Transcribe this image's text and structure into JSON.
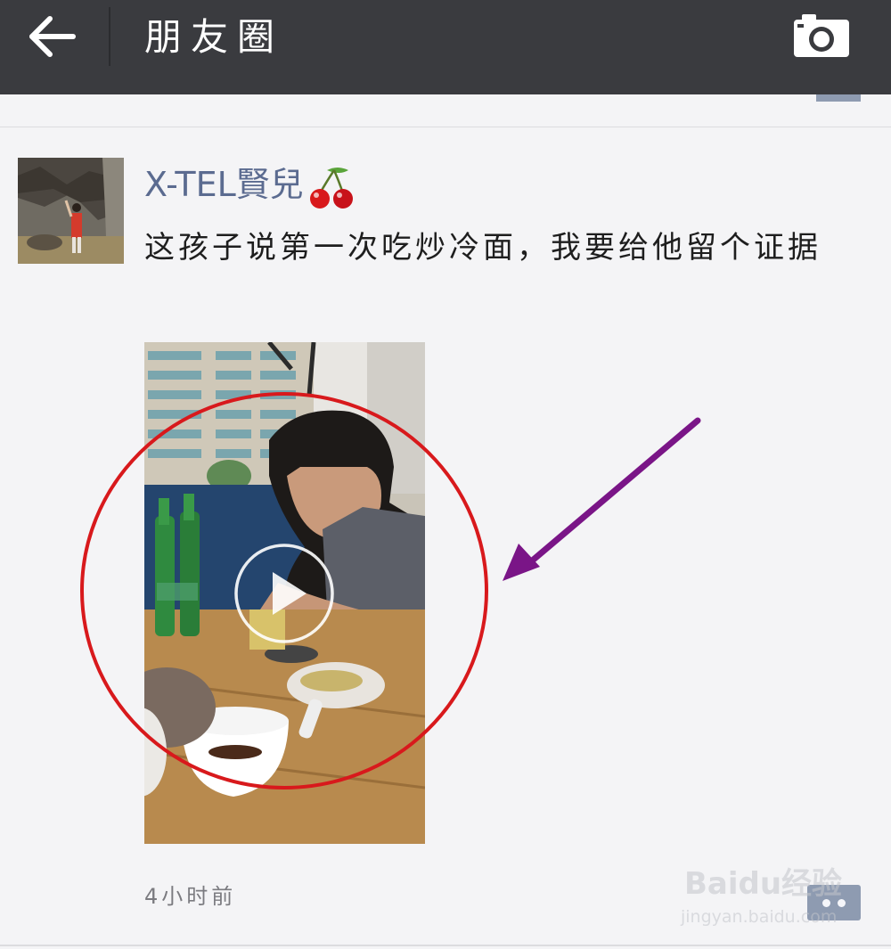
{
  "header": {
    "title": "朋友圈",
    "back_icon": "arrow-left-icon",
    "camera_icon": "camera-icon"
  },
  "post": {
    "author": "X-TEL賢兒",
    "author_emoji": "cherry-icon",
    "text": "这孩子说第一次吃炒冷面，我要给他留个证据",
    "media": "video-thumbnail",
    "play_icon": "play-icon",
    "time": "4小时前",
    "more_icon": "more-options-icon"
  },
  "annotations": {
    "circle_color": "#d8191c",
    "arrow_color": "#7a1587"
  },
  "watermark": {
    "logo": "Baidu经验",
    "url": "jingyan.baidu.com"
  },
  "colors": {
    "topbar": "#3a3b3f",
    "author_name": "#5b6b90",
    "background": "#f4f4f6"
  }
}
